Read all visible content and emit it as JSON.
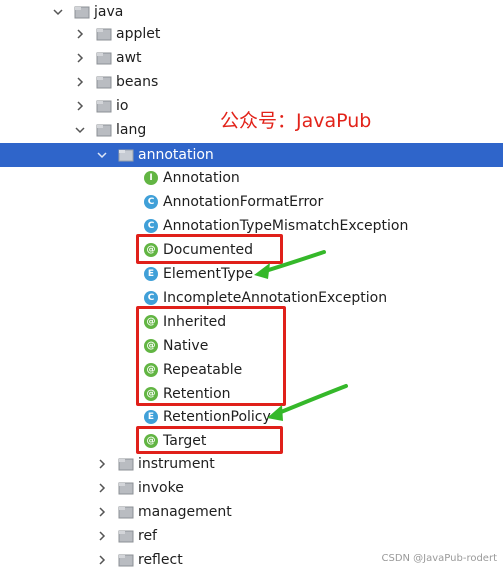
{
  "watermark": "公众号：JavaPub",
  "credit": "CSDN @JavaPub-rodert",
  "colors": {
    "selection": "#2f65ca",
    "highlight_box": "#e0201a",
    "arrow": "#35b82a",
    "annotation_icon": "#62b543",
    "class_icon": "#40a0d8",
    "enum_icon": "#40a0d8",
    "interface_icon": "#62b543"
  },
  "tree": {
    "java": "java",
    "applet": "applet",
    "awt": "awt",
    "beans": "beans",
    "io": "io",
    "lang": "lang",
    "annotation": "annotation",
    "items": [
      {
        "name": "Annotation",
        "icon_letter": "I",
        "kind": "interface"
      },
      {
        "name": "AnnotationFormatError",
        "icon_letter": "C",
        "kind": "class"
      },
      {
        "name": "AnnotationTypeMismatchException",
        "icon_letter": "C",
        "kind": "class"
      },
      {
        "name": "Documented",
        "icon_letter": "@",
        "kind": "annotation"
      },
      {
        "name": "ElementType",
        "icon_letter": "E",
        "kind": "enum"
      },
      {
        "name": "IncompleteAnnotationException",
        "icon_letter": "C",
        "kind": "class"
      },
      {
        "name": "Inherited",
        "icon_letter": "@",
        "kind": "annotation"
      },
      {
        "name": "Native",
        "icon_letter": "@",
        "kind": "annotation"
      },
      {
        "name": "Repeatable",
        "icon_letter": "@",
        "kind": "annotation"
      },
      {
        "name": "Retention",
        "icon_letter": "@",
        "kind": "annotation"
      },
      {
        "name": "RetentionPolicy",
        "icon_letter": "E",
        "kind": "enum"
      },
      {
        "name": "Target",
        "icon_letter": "@",
        "kind": "annotation"
      }
    ],
    "instrument": "instrument",
    "invoke": "invoke",
    "management": "management",
    "ref": "ref",
    "reflect": "reflect"
  }
}
